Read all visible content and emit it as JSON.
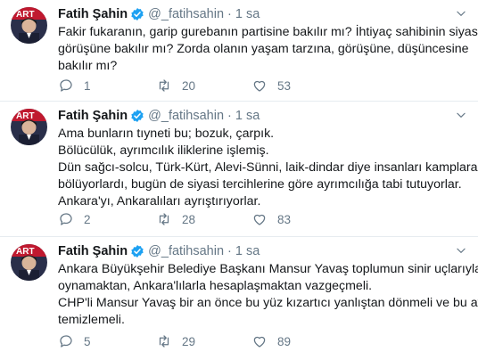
{
  "author": {
    "name": "Fatih Şahin",
    "handle": "@_fatihsahin",
    "time": "1 sa",
    "avatar_text_top": "ART",
    "avatar_text_bottom": "BAŞK",
    "verified_color": "#1da1f2",
    "accent_bg": "#b8152a"
  },
  "tweets": [
    {
      "lines": [
        "Fakir fukaranın, garip gurebanın partisine bakılır mı? İhtiyaç sahibinin siyasi",
        "görüşüne bakılır mı? Zorda olanın yaşam tarzına, görüşüne, düşüncesine",
        "bakılır mı?"
      ],
      "replies": "1",
      "retweets": "20",
      "likes": "53"
    },
    {
      "lines": [
        "Ama bunların tıyneti bu; bozuk, çarpık.",
        "Bölücülük, ayrımcılık iliklerine işlemiş.",
        "Dün sağcı-solcu, Türk-Kürt, Alevi-Sünni, laik-dindar diye insanları kamplara",
        "bölüyorlardı, bugün de siyasi tercihlerine göre ayrımcılığa tabi tutuyorlar.",
        "Ankara'yı, Ankaralıları ayrıştırıyorlar."
      ],
      "replies": "2",
      "retweets": "28",
      "likes": "83"
    },
    {
      "lines": [
        "Ankara Büyükşehir Belediye Başkanı Mansur Yavaş toplumun sinir uçlarıyla",
        "oynamaktan, Ankara'lılarla hesaplaşmaktan vazgeçmeli.",
        "CHP'li Mansur Yavaş bir an önce bu yüz kızartıcı yanlıştan dönmeli ve bu ayıbı",
        "temizlemeli."
      ],
      "replies": "5",
      "retweets": "29",
      "likes": "89"
    }
  ],
  "icons": {
    "reply": "reply-icon",
    "retweet": "retweet-icon",
    "like": "like-icon",
    "caret": "chevron-down-icon",
    "verified": "verified-badge-icon"
  }
}
